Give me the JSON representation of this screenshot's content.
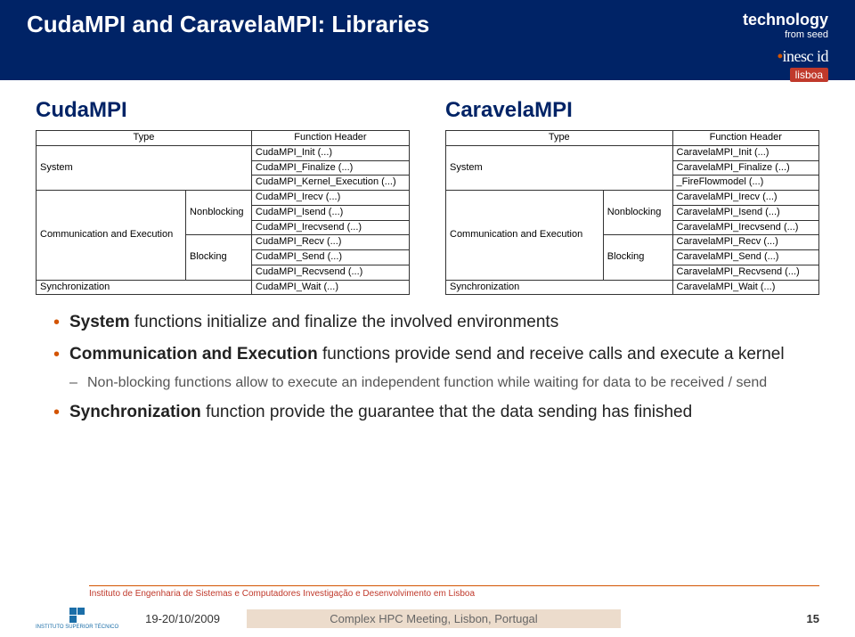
{
  "header": {
    "title": "CudaMPI and CaravelaMPI: Libraries",
    "tech": "technology",
    "tech_sub": "from seed",
    "logo_main": "inesc id",
    "logo_sub": "lisboa"
  },
  "left": {
    "title": "CudaMPI",
    "th_type": "Type",
    "th_fn": "Function Header",
    "r_system": "System",
    "r_commexec": "Communication and Execution",
    "r_nonblock": "Nonblocking",
    "r_block": "Blocking",
    "r_sync": "Synchronization",
    "f_init": "CudaMPI_Init (...)",
    "f_finalize": "CudaMPI_Finalize (...)",
    "f_kernel": "CudaMPI_Kernel_Execution (...)",
    "f_irecv": "CudaMPI_Irecv (...)",
    "f_isend": "CudaMPI_Isend (...)",
    "f_irecvsend": "CudaMPI_Irecvsend (...)",
    "f_recv": "CudaMPI_Recv (...)",
    "f_send": "CudaMPI_Send (...)",
    "f_recvsend": "CudaMPI_Recvsend (...)",
    "f_wait": "CudaMPI_Wait (...)"
  },
  "right": {
    "title": "CaravelaMPI",
    "th_type": "Type",
    "th_fn": "Function Header",
    "r_system": "System",
    "r_commexec": "Communication and Execution",
    "r_nonblock": "Nonblocking",
    "r_block": "Blocking",
    "r_sync": "Synchronization",
    "f_init": "CaravelaMPI_Init (...)",
    "f_finalize": "CaravelaMPI_Finalize (...)",
    "f_fire": "_FireFlowmodel (...)",
    "f_irecv": "CaravelaMPI_Irecv (...)",
    "f_isend": "CaravelaMPI_Isend (...)",
    "f_irecvsend": "CaravelaMPI_Irecvsend (...)",
    "f_recv": "CaravelaMPI_Recv (...)",
    "f_send": "CaravelaMPI_Send (...)",
    "f_recvsend": "CaravelaMPI_Recvsend (...)",
    "f_wait": "CaravelaMPI_Wait (...)"
  },
  "bullets": {
    "b1_bold": "System",
    "b1_rest": " functions initialize and finalize the involved environments",
    "b2_bold": "Communication and Execution",
    "b2_rest": " functions provide send and receive calls and execute a kernel",
    "b2_sub": "Non-blocking functions allow to execute an independent function while waiting for data to be received / send",
    "b3_bold": "Synchronization",
    "b3_rest": " function provide the guarantee that the data sending has finished"
  },
  "footer": {
    "inst": "Instituto de Engenharia de Sistemas e Computadores Investigação e Desenvolvimento em Lisboa",
    "ist": "INSTITUTO SUPERIOR TÉCNICO",
    "date": "19-20/10/2009",
    "center": "Complex HPC Meeting, Lisbon, Portugal",
    "page": "15"
  }
}
